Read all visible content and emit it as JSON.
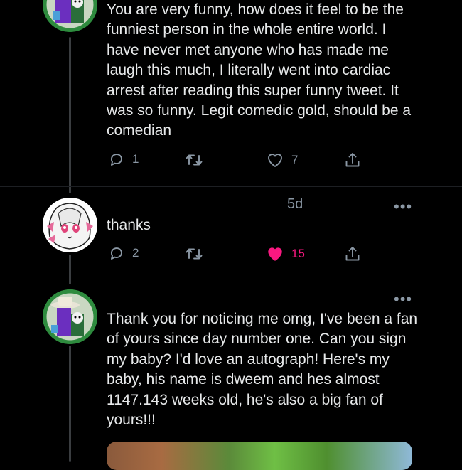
{
  "tweets": [
    {
      "text": "You are very funny, how does it feel to be the funniest person in the whole entire world. I have never met anyone who has made me laugh this much, I literally went into cardiac arrest after reading this super funny tweet. It was so funny. Legit comedic gold, should be a comedian",
      "replies": "1",
      "likes": "7",
      "liked": false,
      "avatar": "purple-character-avatar"
    },
    {
      "timestamp": "5d",
      "text": "thanks",
      "replies": "2",
      "likes": "15",
      "liked": true,
      "like_color": "#f91880",
      "avatar": "anime-girl-avatar"
    },
    {
      "text": "Thank you for noticing me omg, I've been a fan of yours since day number one. Can you sign my baby? I'd love an autograph! Here's my baby, his name is dweem and hes almost 1147.143 weeks old, he's also a big fan of yours!!!",
      "avatar": "cowboy-character-avatar"
    }
  ],
  "icons": {
    "reply": "reply-icon",
    "retweet": "retweet-icon",
    "like": "heart-icon",
    "share": "share-icon",
    "more": "more-icon",
    "more_glyph": "•••"
  },
  "colors": {
    "background": "#000000",
    "text": "#e7e9ea",
    "muted": "#8b98a5",
    "like_active": "#f91880"
  }
}
